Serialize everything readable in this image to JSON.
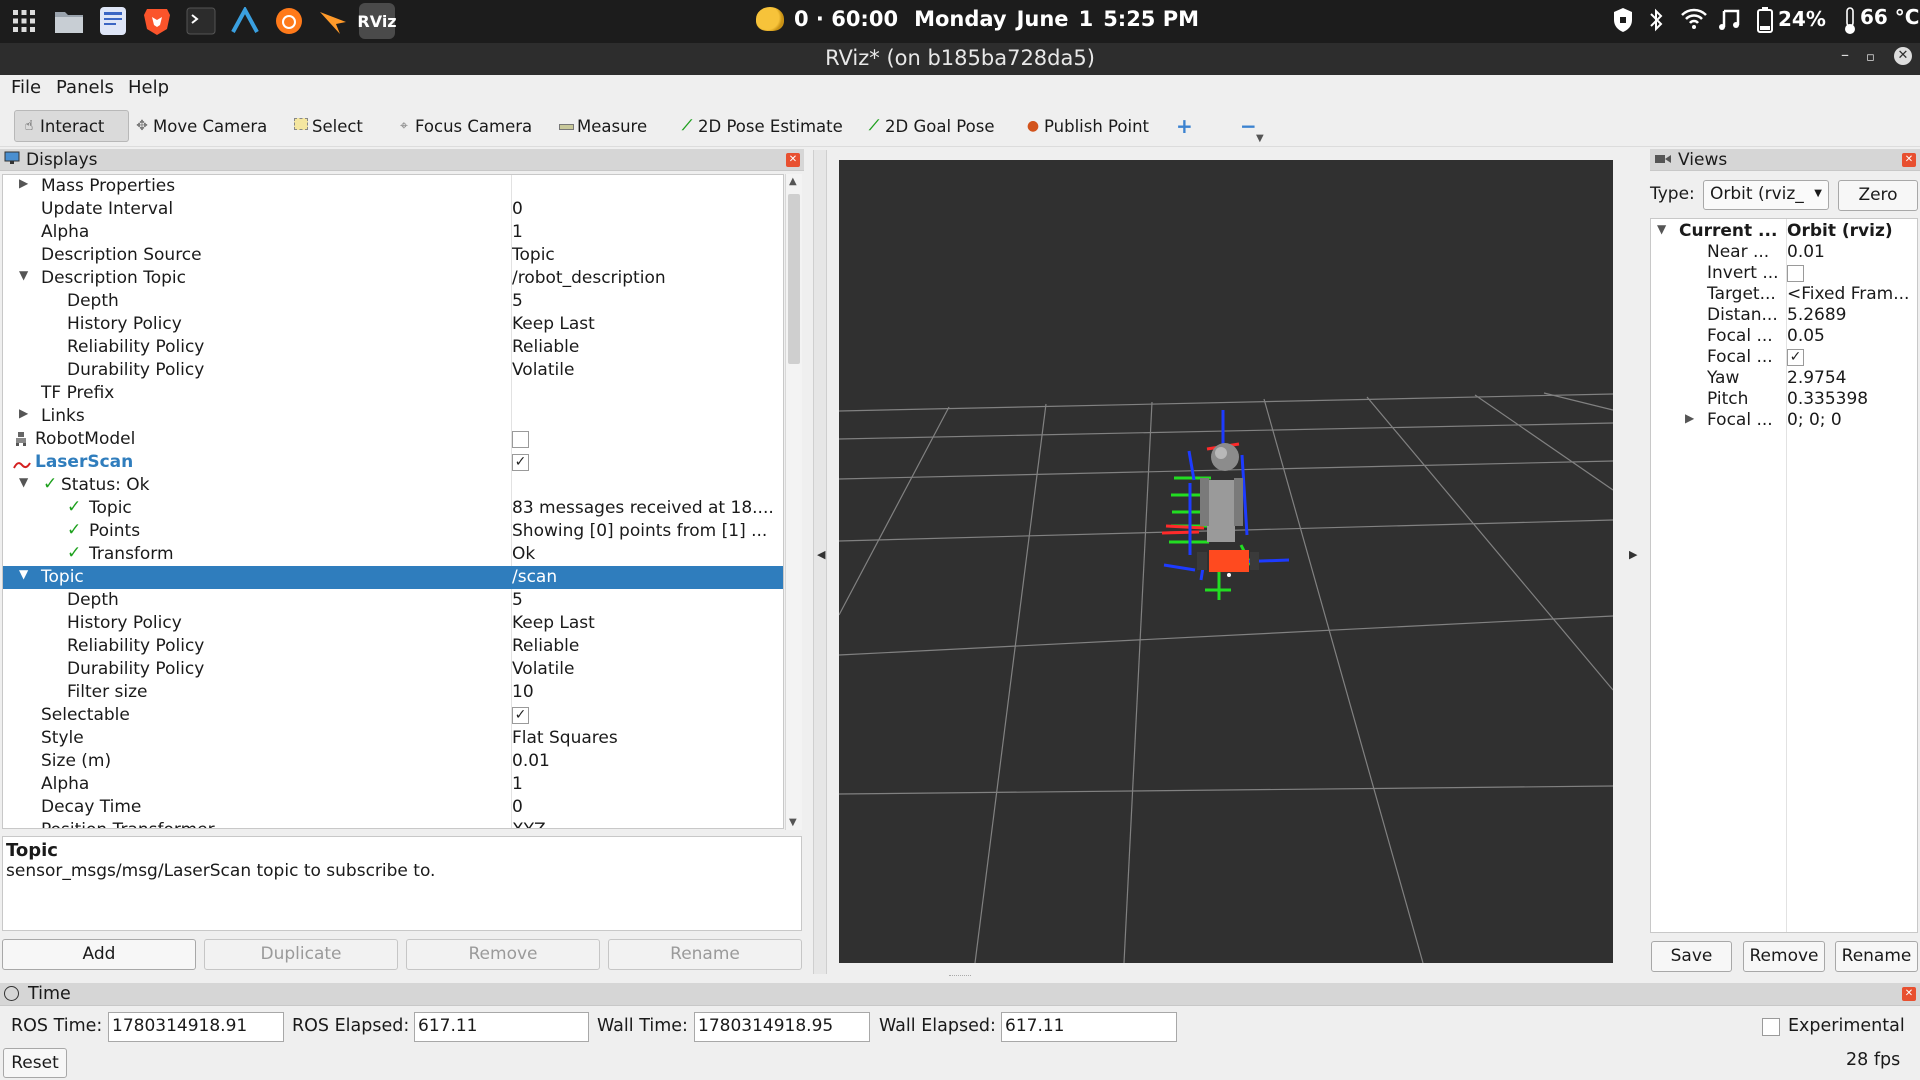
{
  "topbar": {
    "clock": {
      "weather": "0 · 60:00",
      "day": "Monday",
      "month": "June",
      "date": "1",
      "time": "5:25 PM"
    },
    "battery": "24%",
    "temperature": "66 °C",
    "dock_rviz_label": "RViz"
  },
  "window": {
    "title": "RViz* (on b185ba728da5)"
  },
  "menu": {
    "file": "File",
    "panels": "Panels",
    "help": "Help"
  },
  "toolbar": {
    "interact": "Interact",
    "move_camera": "Move Camera",
    "select": "Select",
    "focus_camera": "Focus Camera",
    "measure": "Measure",
    "pose_estimate": "2D Pose Estimate",
    "goal_pose": "2D Goal Pose",
    "publish_point": "Publish Point"
  },
  "displays": {
    "title": "Displays",
    "rows": [
      {
        "label": "Mass Properties",
        "value": ""
      },
      {
        "label": "Update Interval",
        "value": "0"
      },
      {
        "label": "Alpha",
        "value": "1"
      },
      {
        "label": "Description Source",
        "value": "Topic"
      },
      {
        "label": "Description Topic",
        "value": "/robot_description"
      },
      {
        "label": "Depth",
        "value": "5"
      },
      {
        "label": "History Policy",
        "value": "Keep Last"
      },
      {
        "label": "Reliability Policy",
        "value": "Reliable"
      },
      {
        "label": "Durability Policy",
        "value": "Volatile"
      },
      {
        "label": "TF Prefix",
        "value": ""
      },
      {
        "label": "Links",
        "value": ""
      },
      {
        "label": "RobotModel",
        "value": ""
      },
      {
        "label": "LaserScan",
        "value": ""
      },
      {
        "label": "Status: Ok",
        "value": ""
      },
      {
        "label": "Topic",
        "value": "83 messages received at 18...."
      },
      {
        "label": "Points",
        "value": "Showing [0] points from [1] ..."
      },
      {
        "label": "Transform",
        "value": "Ok"
      },
      {
        "label": "Topic",
        "value": "/scan"
      },
      {
        "label": "Depth",
        "value": "5"
      },
      {
        "label": "History Policy",
        "value": "Keep Last"
      },
      {
        "label": "Reliability Policy",
        "value": "Reliable"
      },
      {
        "label": "Durability Policy",
        "value": "Volatile"
      },
      {
        "label": "Filter size",
        "value": "10"
      },
      {
        "label": "Selectable",
        "value": ""
      },
      {
        "label": "Style",
        "value": "Flat Squares"
      },
      {
        "label": "Size (m)",
        "value": "0.01"
      },
      {
        "label": "Alpha",
        "value": "1"
      },
      {
        "label": "Decay Time",
        "value": "0"
      },
      {
        "label": "Position Transformer",
        "value": "XYZ"
      }
    ],
    "robotmodel_checked": false,
    "laserscan_checked": true,
    "selectable_checked": true
  },
  "description": {
    "title": "Topic",
    "text": "sensor_msgs/msg/LaserScan topic to subscribe to."
  },
  "display_buttons": {
    "add": "Add",
    "duplicate": "Duplicate",
    "remove": "Remove",
    "rename": "Rename"
  },
  "views": {
    "title": "Views",
    "type_label": "Type:",
    "type_value": "Orbit (rviz_",
    "zero": "Zero",
    "rows": [
      {
        "label": "Current ...",
        "value": "Orbit (rviz)"
      },
      {
        "label": "Near ...",
        "value": "0.01"
      },
      {
        "label": "Invert ...",
        "value": ""
      },
      {
        "label": "Target...",
        "value": "<Fixed Fram..."
      },
      {
        "label": "Distan...",
        "value": "5.2689"
      },
      {
        "label": "Focal ...",
        "value": "0.05"
      },
      {
        "label": "Focal ...",
        "value": ""
      },
      {
        "label": "Yaw",
        "value": "2.9754"
      },
      {
        "label": "Pitch",
        "value": "0.335398"
      },
      {
        "label": "Focal ...",
        "value": "0; 0; 0"
      }
    ],
    "invert_checked": false,
    "focal_shape_checked": true,
    "save": "Save",
    "remove": "Remove",
    "rename": "Rename"
  },
  "time": {
    "title": "Time",
    "ros_time_label": "ROS Time:",
    "ros_time": "1780314918.91",
    "ros_elapsed_label": "ROS Elapsed:",
    "ros_elapsed": "617.11",
    "wall_time_label": "Wall Time:",
    "wall_time": "1780314918.95",
    "wall_elapsed_label": "Wall Elapsed:",
    "wall_elapsed": "617.11",
    "experimental": "Experimental",
    "experimental_checked": false,
    "reset": "Reset",
    "fps": "28 fps"
  }
}
